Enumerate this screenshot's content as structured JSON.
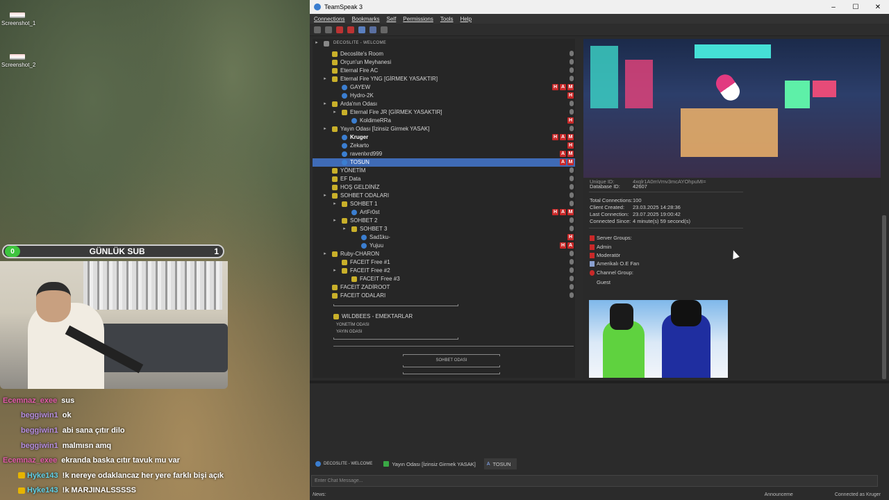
{
  "desktop": {
    "icons": [
      {
        "label": "Screenshot_1"
      },
      {
        "label": "Screenshot_2"
      }
    ]
  },
  "overlay": {
    "sub_title": "GÜNLÜK SUB",
    "sub_count_left": "0",
    "sub_count_right": "1"
  },
  "stream_chat": [
    {
      "user": "Ecemnaz_exee",
      "color": "#e05aa8",
      "msg": "sus",
      "badge": false
    },
    {
      "user": "beggiwin1",
      "color": "#b58de0",
      "msg": "ok",
      "badge": false
    },
    {
      "user": "beggiwin1",
      "color": "#b58de0",
      "msg": "abi sana çıtır dilo",
      "badge": false
    },
    {
      "user": "beggiwin1",
      "color": "#b58de0",
      "msg": "malmısn amq",
      "badge": false
    },
    {
      "user": "Ecemnaz_exee",
      "color": "#e05aa8",
      "msg": "ekranda baska cıtır tavuk mu var",
      "badge": false
    },
    {
      "user": "Hyke143",
      "color": "#5fd0e8",
      "msg": "!k nereye odaklancaz her yere farklı bişi açık",
      "badge": true
    },
    {
      "user": "Hyke143",
      "color": "#5fd0e8",
      "msg": "!k MARJINALSSSSS",
      "badge": true
    }
  ],
  "teamspeak": {
    "title": "TeamSpeak 3",
    "menu": [
      "Connections",
      "Bookmarks",
      "Self",
      "Permissions",
      "Tools",
      "Help"
    ],
    "server_name": "DECOSLITE - WELCOME",
    "tree": [
      {
        "label": "Decoslite's Room",
        "indent": 1,
        "type": "channel",
        "arrow": ""
      },
      {
        "label": "Orçun'un Meyhanesi",
        "indent": 1,
        "type": "channel",
        "arrow": ""
      },
      {
        "label": "Eternal Fire AC",
        "indent": 1,
        "type": "channel",
        "arrow": ""
      },
      {
        "label": "Eternal Fire YNG [GİRMEK YASAKTIR]",
        "indent": 1,
        "type": "channel",
        "arrow": "▸"
      },
      {
        "label": "GAYEW",
        "indent": 2,
        "type": "user",
        "arrow": "",
        "tags": [
          "H",
          "A",
          "M"
        ]
      },
      {
        "label": "Hydro-2K",
        "indent": 2,
        "type": "user",
        "arrow": "",
        "tags": [
          "H"
        ]
      },
      {
        "label": "Arda'nın Odası",
        "indent": 1,
        "type": "channel",
        "arrow": "▸"
      },
      {
        "label": "Eternal Fire JR [GİRMEK YASAKTIR]",
        "indent": 2,
        "type": "channel",
        "arrow": "▸"
      },
      {
        "label": "KoldimeRRa",
        "indent": 3,
        "type": "user",
        "arrow": "",
        "tags": [
          "H"
        ]
      },
      {
        "label": "Yayın Odası [İzinsiz Girmek YASAK]",
        "indent": 1,
        "type": "channel",
        "arrow": "▸"
      },
      {
        "label": "Kruger",
        "indent": 2,
        "type": "user",
        "arrow": "",
        "bold": true,
        "tags": [
          "H",
          "A",
          "M"
        ]
      },
      {
        "label": "Zekarto",
        "indent": 2,
        "type": "user",
        "arrow": "",
        "tags": [
          "H"
        ]
      },
      {
        "label": "ravenlxrd999",
        "indent": 2,
        "type": "user",
        "arrow": "",
        "tags": [
          "A",
          "M"
        ]
      },
      {
        "label": "TOSUN",
        "indent": 2,
        "type": "user",
        "arrow": "",
        "selected": true,
        "tags": [
          "A",
          "M"
        ]
      },
      {
        "label": "YÖNETİM",
        "indent": 1,
        "type": "channel",
        "arrow": ""
      },
      {
        "label": "EF Data",
        "indent": 1,
        "type": "channel",
        "arrow": ""
      },
      {
        "label": "HOŞ GELDİNİZ",
        "indent": 1,
        "type": "channel",
        "arrow": ""
      },
      {
        "label": "SOHBET ODALARI",
        "indent": 1,
        "type": "channel",
        "arrow": "▸"
      },
      {
        "label": "SOHBET 1",
        "indent": 2,
        "type": "channel",
        "arrow": "▸"
      },
      {
        "label": "ArtFr0st",
        "indent": 3,
        "type": "user",
        "arrow": "",
        "tags": [
          "H",
          "A",
          "M"
        ]
      },
      {
        "label": "SOHBET 2",
        "indent": 2,
        "type": "channel",
        "arrow": "▸"
      },
      {
        "label": "SOHBET 3",
        "indent": 3,
        "type": "channel",
        "arrow": "▸"
      },
      {
        "label": "Sad1ku-",
        "indent": 4,
        "type": "user",
        "arrow": "",
        "tags": [
          "H"
        ]
      },
      {
        "label": "Yujuu",
        "indent": 4,
        "type": "user",
        "arrow": "",
        "tags": [
          "H",
          "A"
        ]
      },
      {
        "label": "Ruby-CHARON",
        "indent": 1,
        "type": "channel",
        "arrow": "▸"
      },
      {
        "label": "FACEIT Free #1",
        "indent": 2,
        "type": "channel",
        "arrow": ""
      },
      {
        "label": "FACEIT Free #2",
        "indent": 2,
        "type": "channel",
        "arrow": "▸"
      },
      {
        "label": "FACEIT Free #3",
        "indent": 3,
        "type": "channel",
        "arrow": ""
      },
      {
        "label": "FACEIT ZADİROOT",
        "indent": 1,
        "type": "channel",
        "arrow": ""
      },
      {
        "label": "FACEIT ODALARI",
        "indent": 1,
        "type": "channel",
        "arrow": ""
      }
    ],
    "tree_extra": {
      "wildbees": "WILDBEES - EMEKTARLAR",
      "yonetim_odasi": "YONETİM ODASI",
      "yayin_odasi": "YAYIN ODASI",
      "sohbet_odasi": "SOHBET ODASI"
    },
    "info": {
      "unique_id_label": "Unique ID:",
      "unique_id_value": "4xqlr1A0mVmv3mcAYOhpuMI=",
      "database_id_label": "Database ID:",
      "database_id_value": "42607",
      "total_connections_label": "Total Connections:",
      "total_connections_value": "100",
      "client_created_label": "Client Created:",
      "client_created_value": "23.03.2025 14:28:36",
      "last_connection_label": "Last Connection:",
      "last_connection_value": "23.07.2025 19:00:42",
      "connected_since_label": "Connected Since:",
      "connected_since_value": "4 minute(s) 59 second(s)",
      "server_groups_label": "Server Groups:",
      "server_groups": [
        "Admin",
        "Moderatör",
        "Amerikalı O.E Fan"
      ],
      "channel_group_label": "Channel Group:",
      "channel_group_value": "Guest"
    },
    "tabs": [
      {
        "label": "DECOSLITE - WELCOME",
        "active": false
      },
      {
        "label": "Yayın Odası [İzinsiz Girmek YASAK]",
        "active": false
      },
      {
        "label": "TOSUN",
        "active": true
      }
    ],
    "chat_input_placeholder": "Enter Chat Message...",
    "status": {
      "news": "News:",
      "announcement": "Announceme",
      "connected": "Connected as Kruger"
    },
    "colors": {
      "accent": "#3f6bb6",
      "badge_red": "#c92929"
    }
  }
}
